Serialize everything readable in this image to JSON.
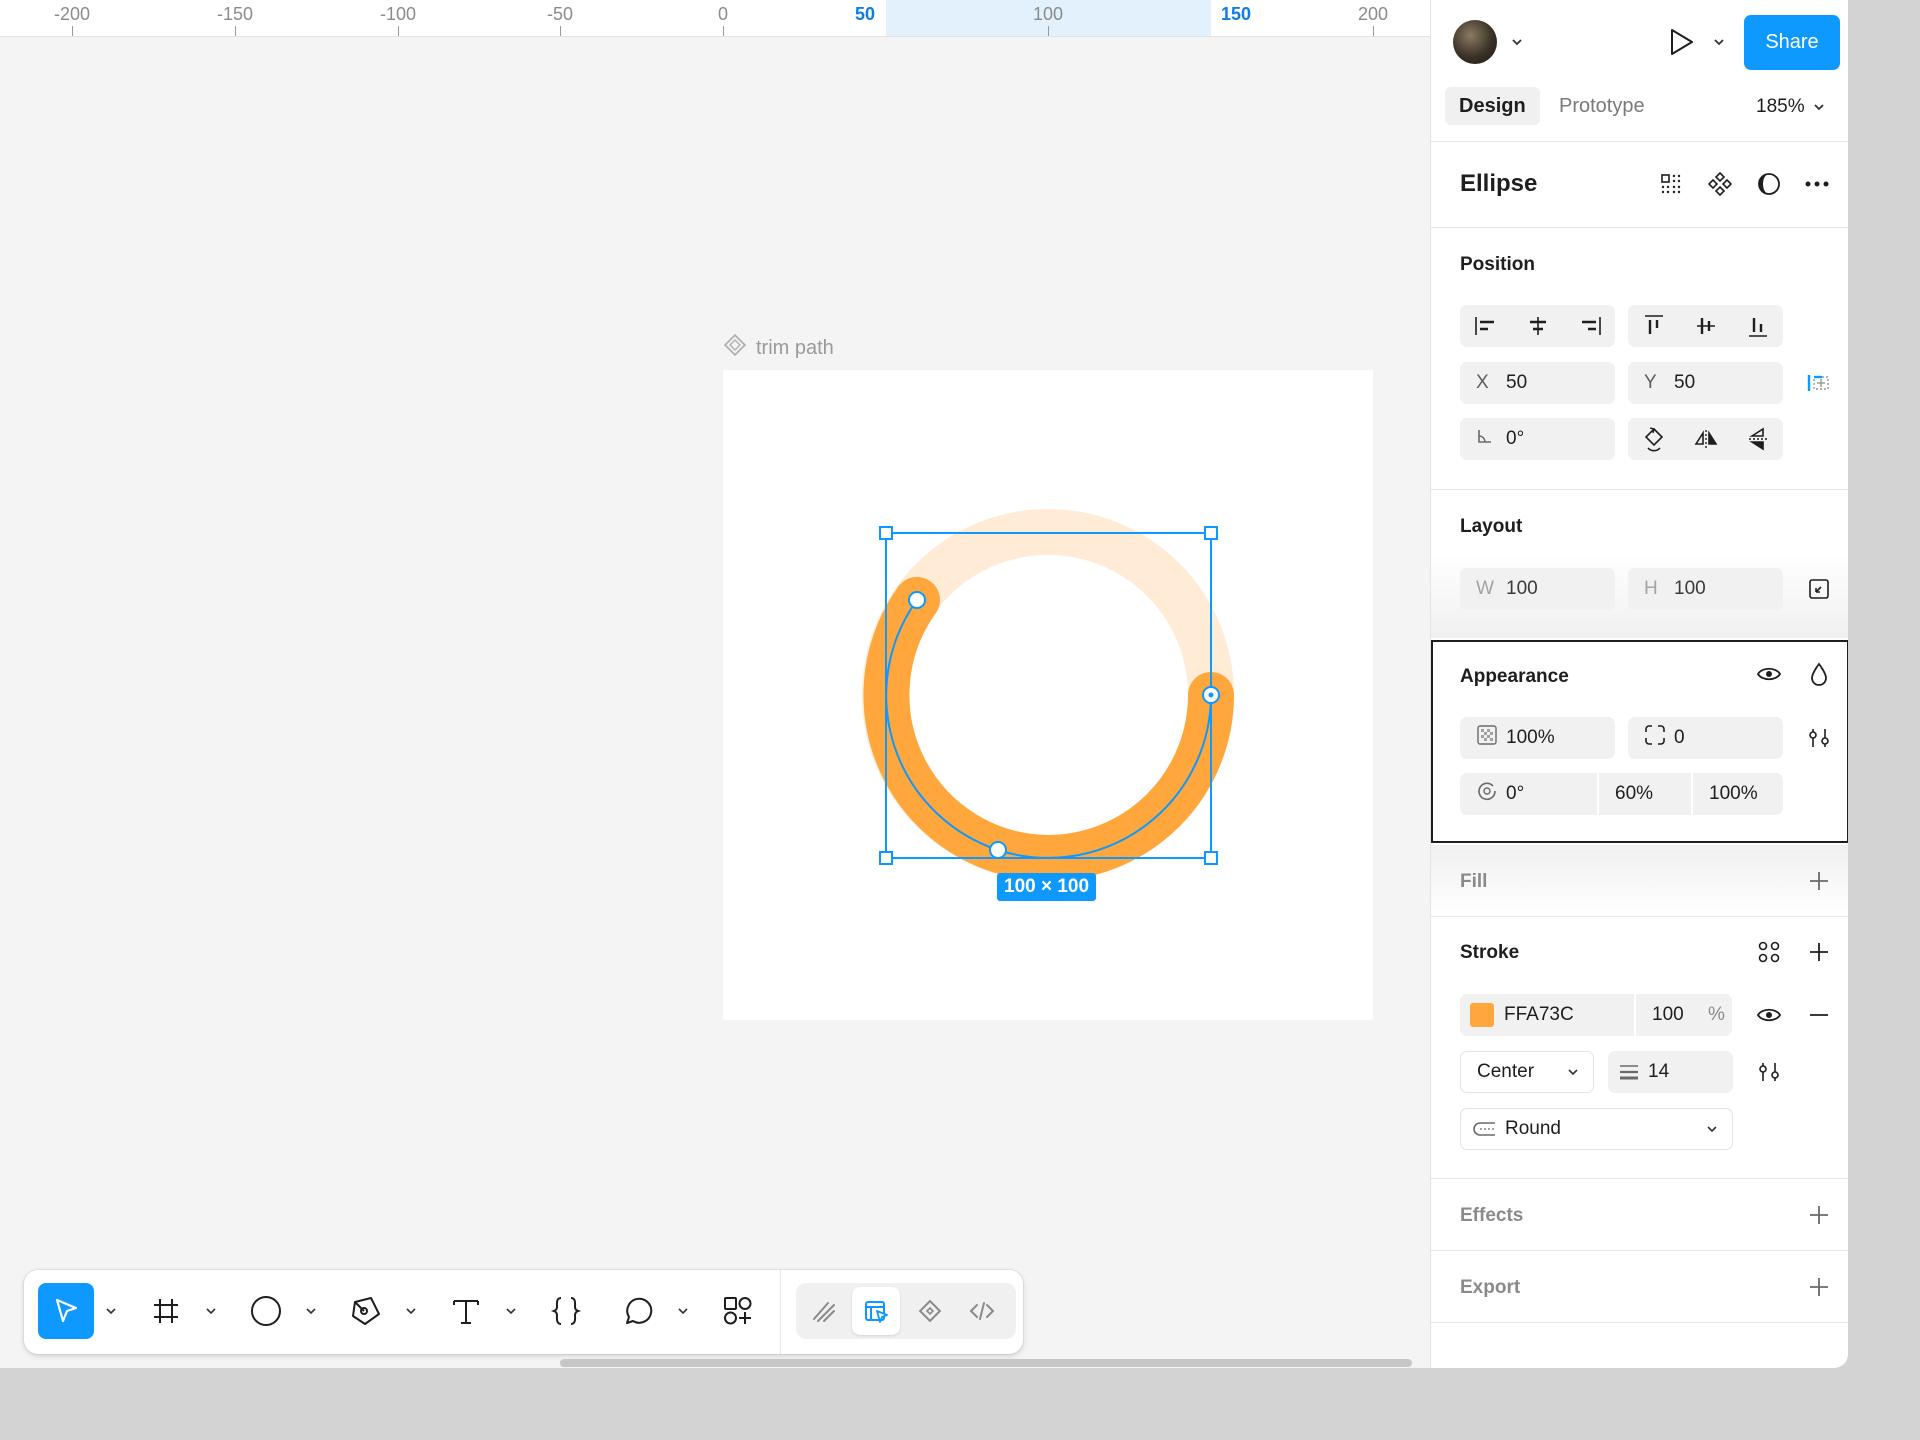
{
  "ruler": {
    "labels": [
      "-200",
      "-150",
      "-100",
      "-50",
      "0",
      "50",
      "100",
      "150",
      "200"
    ]
  },
  "canvas": {
    "frame_label": "trim path",
    "dimension_badge": "100 × 100",
    "stroke_color": "#FFA73C",
    "track_color": "#FFEBD6",
    "selection_color": "#0D99FF"
  },
  "toolbar": {
    "tools": [
      "move-tool",
      "frame-tool",
      "ellipse-tool",
      "pen-tool",
      "text-tool",
      "code-tool",
      "comment-tool",
      "assets-tool"
    ],
    "modes": [
      "draw-mode",
      "design-mode",
      "dev-components",
      "dev-mode"
    ]
  },
  "panel": {
    "share_label": "Share",
    "tabs": [
      "Design",
      "Prototype"
    ],
    "zoom": "185%",
    "layer_title": "Ellipse",
    "position": {
      "title": "Position",
      "x_label": "X",
      "x_value": "50",
      "y_label": "Y",
      "y_value": "50",
      "rotation": "0°"
    },
    "layout": {
      "title": "Layout",
      "w_label": "W",
      "w_value": "100",
      "h_label": "H",
      "h_value": "100"
    },
    "appearance": {
      "title": "Appearance",
      "opacity": "100%",
      "corner_radius": "0",
      "arc_start": "0°",
      "arc_sweep": "60%",
      "arc_ratio": "100%"
    },
    "fill": {
      "title": "Fill"
    },
    "stroke": {
      "title": "Stroke",
      "hex": "FFA73C",
      "color": "#FFA73C",
      "opacity": "100",
      "opacity_unit": "%",
      "position": "Center",
      "weight": "14",
      "cap": "Round"
    },
    "effects": {
      "title": "Effects"
    },
    "export": {
      "title": "Export"
    }
  }
}
